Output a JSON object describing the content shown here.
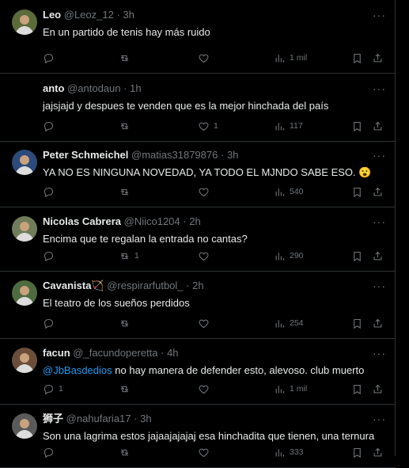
{
  "tweets": [
    {
      "name": "Leo",
      "handle": "@Leoz_12",
      "time": "3h",
      "text": "En un partido de tenis hay más ruido",
      "mention": "",
      "replies": "",
      "retweets": "",
      "likes": "",
      "views": "1 mil",
      "avatar": true
    },
    {
      "name": "anto",
      "handle": "@antodaun",
      "time": "1h",
      "text": "jajsjajd y despues te venden que es la mejor hinchada del país",
      "mention": "",
      "replies": "",
      "retweets": "",
      "likes": "1",
      "views": "117",
      "avatar": false
    },
    {
      "name": "Peter Schmeichel",
      "handle": "@matias31879876",
      "time": "3h",
      "text": "YA NO ES NINGUNA NOVEDAD, YA TODO EL MJNDO SABE ESO. 😮",
      "mention": "",
      "replies": "",
      "retweets": "",
      "likes": "",
      "views": "540",
      "avatar": true
    },
    {
      "name": "Nicolas Cabrera",
      "handle": "@Niico1204",
      "time": "2h",
      "text": "Encima que te regalan la entrada no cantas?",
      "mention": "",
      "replies": "",
      "retweets": "1",
      "likes": "",
      "views": "290",
      "avatar": true
    },
    {
      "name": "Cavanista🏹",
      "handle": "@respirarfutbol_",
      "time": "2h",
      "text": "El teatro de los sueños perdidos",
      "mention": "",
      "replies": "",
      "retweets": "",
      "likes": "",
      "views": "254",
      "avatar": true
    },
    {
      "name": "facun",
      "handle": "@_facundoperetta",
      "time": "4h",
      "text": "no hay manera de defender esto, alevoso. club muerto",
      "mention": "@JbBasdedios",
      "replies": "1",
      "retweets": "",
      "likes": "",
      "views": "1 mil",
      "avatar": true
    },
    {
      "name": "狮子",
      "handle": "@nahufaria17",
      "time": "3h",
      "text": "Son una lagrima estos jajaajajajaj esa hinchadita que tienen, una ternura",
      "mention": "",
      "replies": "",
      "retweets": "",
      "likes": "",
      "views": "333",
      "avatar": true
    }
  ],
  "separator": "·",
  "more_label": "···",
  "icons": {
    "reply": "reply-icon",
    "retweet": "retweet-icon",
    "like": "heart-icon",
    "views": "views-icon",
    "bookmark": "bookmark-icon",
    "share": "share-icon"
  },
  "colors": {
    "background": "#000000",
    "text": "#e7e9ea",
    "muted": "#71767b",
    "link": "#1d9bf0",
    "border": "#2f3336"
  }
}
